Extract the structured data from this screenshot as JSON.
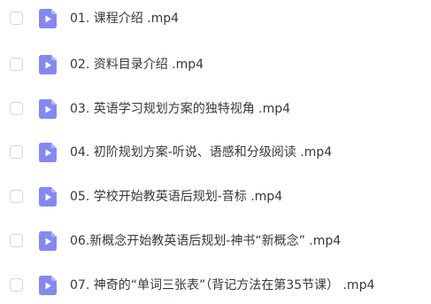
{
  "colors": {
    "icon_bg": "#8688f2",
    "icon_fold": "#b4b6f7",
    "icon_play": "#ffffff",
    "text": "#33393f",
    "checkbox_border": "#d4d6dc"
  },
  "files": [
    {
      "name": "01. 课程介绍 .mp4",
      "icon": "video-file-icon",
      "checked": false
    },
    {
      "name": "02. 资料目录介绍 .mp4",
      "icon": "video-file-icon",
      "checked": false
    },
    {
      "name": "03. 英语学习规划方案的独特视角 .mp4",
      "icon": "video-file-icon",
      "checked": false
    },
    {
      "name": "04. 初阶规划方案-听说、语感和分级阅读 .mp4",
      "icon": "video-file-icon",
      "checked": false
    },
    {
      "name": "05. 学校开始教英语后规划-音标 .mp4",
      "icon": "video-file-icon",
      "checked": false
    },
    {
      "name": "06.新概念开始教英语后规划-神书“新概念” .mp4",
      "icon": "video-file-icon",
      "checked": false
    },
    {
      "name": "07. 神奇的“单词三张表”（背记方法在第35节课） .mp4",
      "icon": "video-file-icon",
      "checked": false
    }
  ]
}
